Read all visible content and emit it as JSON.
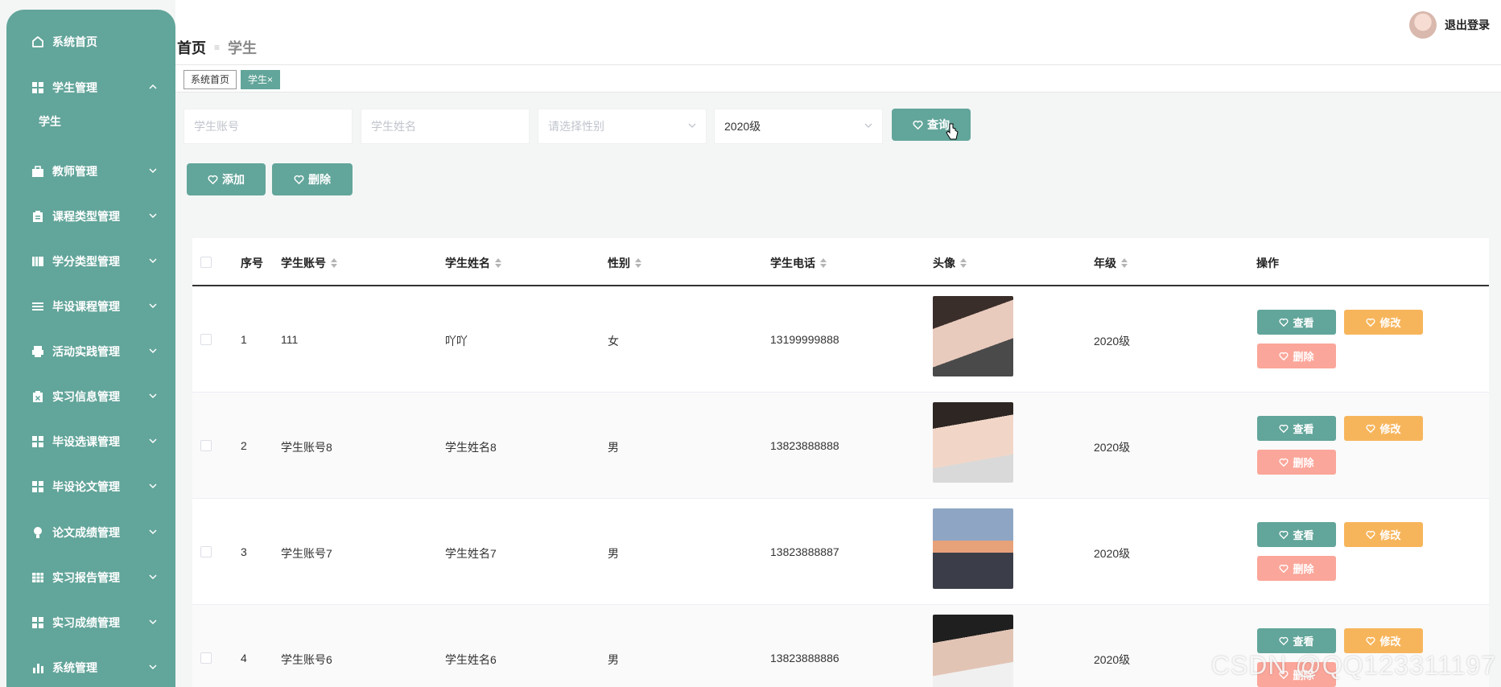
{
  "sidebar": {
    "items": [
      {
        "label": "系统首页",
        "icon": "home-icon"
      },
      {
        "label": "学生管理",
        "icon": "grid-icon",
        "expanded": true
      },
      {
        "label": "教师管理",
        "icon": "briefcase-icon"
      },
      {
        "label": "课程类型管理",
        "icon": "clipboard-icon"
      },
      {
        "label": "学分类型管理",
        "icon": "book-icon"
      },
      {
        "label": "毕设课程管理",
        "icon": "list-icon"
      },
      {
        "label": "活动实践管理",
        "icon": "printer-icon"
      },
      {
        "label": "实习信息管理",
        "icon": "clipboard-x-icon"
      },
      {
        "label": "毕设选课管理",
        "icon": "grid-icon"
      },
      {
        "label": "毕设论文管理",
        "icon": "grid-icon"
      },
      {
        "label": "论文成绩管理",
        "icon": "lightbulb-icon"
      },
      {
        "label": "实习报告管理",
        "icon": "table-icon"
      },
      {
        "label": "实习成绩管理",
        "icon": "grid-icon"
      },
      {
        "label": "系统管理",
        "icon": "bar-chart-icon"
      }
    ],
    "sub_item": "学生"
  },
  "header": {
    "breadcrumb_home": "首页",
    "breadcrumb_sep": "≡",
    "breadcrumb_current": "学生",
    "logout_label": "退出登录"
  },
  "tags": {
    "home": "系统首页",
    "current": "学生",
    "close": "×"
  },
  "search": {
    "account_placeholder": "学生账号",
    "name_placeholder": "学生姓名",
    "gender_placeholder": "请选择性别",
    "grade_value": "2020级",
    "query_label": "查询"
  },
  "actions": {
    "add_label": "添加",
    "delete_label": "删除"
  },
  "table": {
    "headers": {
      "index": "序号",
      "account": "学生账号",
      "name": "学生姓名",
      "gender": "性别",
      "phone": "学生电话",
      "avatar": "头像",
      "grade": "年级",
      "ops": "操作"
    },
    "rows": [
      {
        "index": "1",
        "account": "111",
        "name": "吖吖",
        "gender": "女",
        "phone": "13199999888",
        "grade": "2020级"
      },
      {
        "index": "2",
        "account": "学生账号8",
        "name": "学生姓名8",
        "gender": "男",
        "phone": "13823888888",
        "grade": "2020级"
      },
      {
        "index": "3",
        "account": "学生账号7",
        "name": "学生姓名7",
        "gender": "男",
        "phone": "13823888887",
        "grade": "2020级"
      },
      {
        "index": "4",
        "account": "学生账号6",
        "name": "学生姓名6",
        "gender": "男",
        "phone": "13823888886",
        "grade": "2020级"
      }
    ],
    "op_view": "查看",
    "op_edit": "修改",
    "op_delete": "删除"
  },
  "watermark": "CSDN @QQ123311197",
  "colors": {
    "primary": "#62a59a",
    "edit": "#f7b55b",
    "delete": "#fba69a"
  }
}
